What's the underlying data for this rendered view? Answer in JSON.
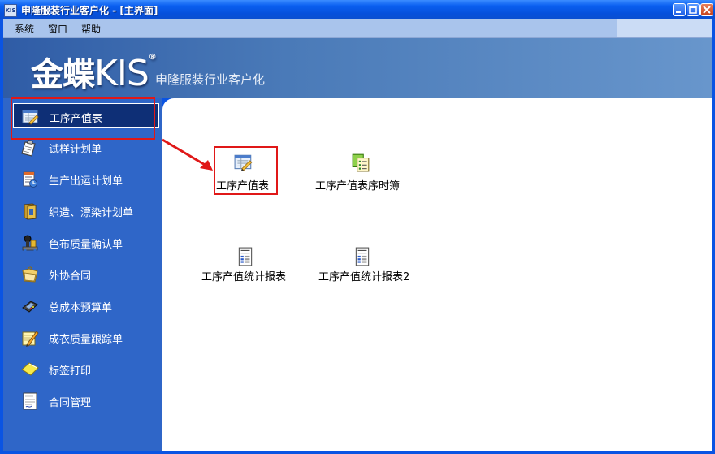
{
  "window": {
    "title": "申隆服装行业客户化 - [主界面]",
    "icon_text": "KIS",
    "controls": [
      "minimize-icon",
      "restore-icon",
      "close-icon"
    ]
  },
  "menubar": {
    "items": [
      "系统",
      "窗口",
      "帮助"
    ]
  },
  "banner": {
    "logo_main": "金蝶",
    "logo_kis": "KIS",
    "logo_mark": "®",
    "subtitle": "申隆服装行业客户化"
  },
  "sidebar": {
    "items": [
      {
        "label": "工序产值表",
        "icon": "table-edit-icon",
        "selected": true
      },
      {
        "label": "试样计划单",
        "icon": "clipboard-icon"
      },
      {
        "label": "生产出运计划单",
        "icon": "report-calendar-icon"
      },
      {
        "label": "织造、漂染计划单",
        "icon": "book-icon"
      },
      {
        "label": "色布质量确认单",
        "icon": "inspect-icon"
      },
      {
        "label": "外协合同",
        "icon": "handshake-folder-icon"
      },
      {
        "label": "总成本预算单",
        "icon": "calculator-icon"
      },
      {
        "label": "成衣质量跟踪单",
        "icon": "pencil-notepad-icon"
      },
      {
        "label": "标签打印",
        "icon": "tag-icon"
      },
      {
        "label": "合同管理",
        "icon": "contract-document-icon"
      }
    ]
  },
  "content": {
    "tiles": [
      {
        "label": "工序产值表",
        "icon": "table-edit-icon",
        "highlighted": true
      },
      {
        "label": "工序产值表序时簿",
        "icon": "list-ledger-icon"
      },
      {
        "label": "工序产值统计报表",
        "icon": "report-sheet-icon"
      },
      {
        "label": "工序产值统计报表2",
        "icon": "report-sheet-icon"
      }
    ]
  },
  "annotations": {
    "highlight_color": "#e01818"
  }
}
